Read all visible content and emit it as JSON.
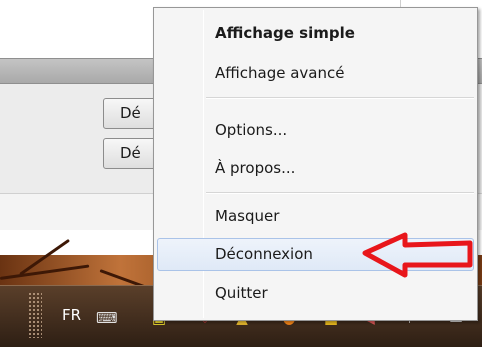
{
  "app": {
    "buttons": [
      {
        "label": "Dé"
      },
      {
        "label": "Dé"
      }
    ]
  },
  "context_menu": {
    "items": [
      {
        "label": "Affichage simple",
        "bold": true
      },
      {
        "label": "Affichage avancé"
      },
      {
        "label": "Options..."
      },
      {
        "label": "À propos..."
      },
      {
        "label": "Masquer"
      },
      {
        "label": "Déconnexion",
        "highlighted": true
      },
      {
        "label": "Quitter"
      }
    ]
  },
  "taskbar": {
    "language": "FR",
    "tray_icons": [
      "keyboard-icon",
      "network-icon",
      "shield-icon",
      "warning-icon",
      "update-icon",
      "folder-icon",
      "volume-icon",
      "flag-icon",
      "show-desktop-icon"
    ]
  },
  "annotation": {
    "type": "arrow",
    "color": "#e8161b",
    "points_to": "Déconnexion"
  }
}
